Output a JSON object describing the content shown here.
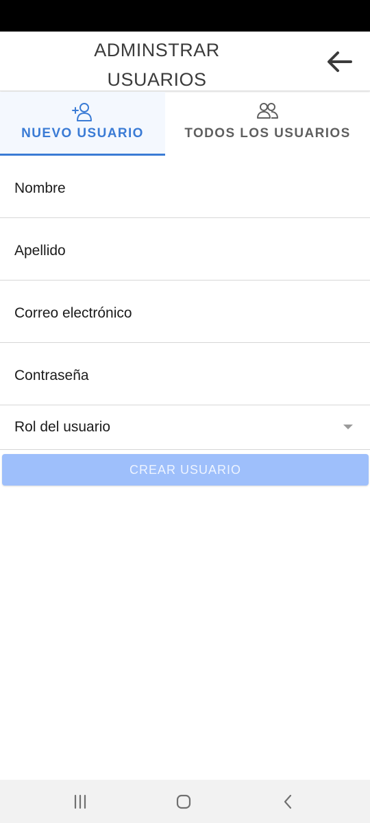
{
  "header": {
    "title_line1": "ADMINSTRAR",
    "title_line2": "USUARIOS",
    "back_icon": "arrow-left-icon"
  },
  "tabs": [
    {
      "label": "NUEVO USUARIO",
      "icon": "add-user-icon",
      "active": true
    },
    {
      "label": "TODOS LOS USUARIOS",
      "icon": "users-icon",
      "active": false
    }
  ],
  "form": {
    "fields": [
      {
        "label": "Nombre"
      },
      {
        "label": "Apellido"
      },
      {
        "label": "Correo electrónico"
      },
      {
        "label": "Contraseña"
      }
    ],
    "role_select": {
      "label": "Rol del usuario"
    },
    "submit_label": "CREAR USUARIO"
  },
  "colors": {
    "accent": "#3a7bd5",
    "button_disabled": "#9ebffb",
    "status_bar": "#000000",
    "nav_bar": "#f2f2f2"
  },
  "system_nav": [
    "recent-apps-icon",
    "home-icon",
    "back-icon"
  ]
}
